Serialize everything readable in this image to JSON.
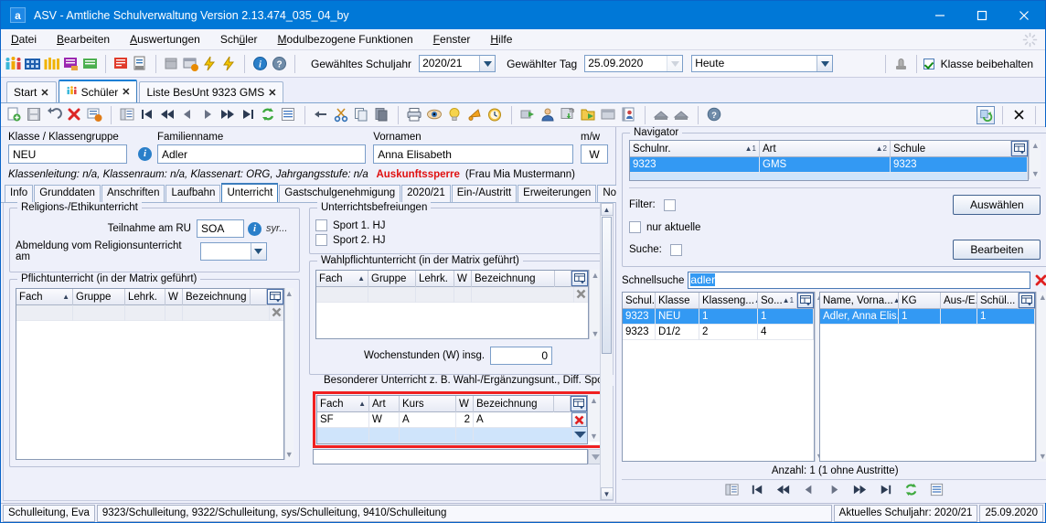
{
  "window": {
    "title": "ASV - Amtliche Schulverwaltung Version 2.13.474_035_04_by",
    "app_icon_letter": "a",
    "minimize_label": "—",
    "maximize_label": "□",
    "close_label": "✕"
  },
  "menu": {
    "items": [
      {
        "label": "Datei",
        "mnemonic": "D"
      },
      {
        "label": "Bearbeiten",
        "mnemonic": "B"
      },
      {
        "label": "Auswertungen",
        "mnemonic": "A"
      },
      {
        "label": "Schüler",
        "mnemonic": "u"
      },
      {
        "label": "Modulbezogene Funktionen",
        "mnemonic": "M"
      },
      {
        "label": "Fenster",
        "mnemonic": "F"
      },
      {
        "label": "Hilfe",
        "mnemonic": "H"
      }
    ]
  },
  "toolbar": {
    "school_year_label": "Gewähltes Schuljahr",
    "school_year_value": "2020/21",
    "day_label": "Gewählter Tag",
    "day_value": "25.09.2020",
    "period_value": "Heute",
    "keep_class_label": "Klasse beibehalten",
    "keep_class_checked": true,
    "icons": [
      "students-icon",
      "school-building-icon",
      "class-icon",
      "report-violet-icon",
      "report-green-icon",
      "book-red-icon",
      "print-report-icon",
      "package-icon",
      "window-alert-icon",
      "lightning-icon",
      "lightning2-icon",
      "info-icon",
      "help-icon",
      "stamp-icon"
    ]
  },
  "tabs": [
    {
      "label": "Start",
      "active": false,
      "icon": "none",
      "closable": true
    },
    {
      "label": "Schüler",
      "active": true,
      "icon": "students-icon",
      "closable": true
    },
    {
      "label": "Liste BesUnt 9323 GMS",
      "active": false,
      "icon": "none",
      "closable": true
    }
  ],
  "doc_toolbar": {
    "icons": [
      "new-icon",
      "save-icon",
      "undo-icon",
      "delete-icon",
      "edit-record-icon",
      "record-list-icon",
      "first-icon",
      "prev-page-icon",
      "prev-icon",
      "next-icon",
      "next-page-icon",
      "last-icon",
      "refresh-icon",
      "list-icon",
      "back-icon",
      "cut-icon",
      "copy-icon",
      "paste-icon",
      "print-icon",
      "preview-icon",
      "hint-icon",
      "bell-icon",
      "clock-icon",
      "export-icon",
      "person-icon",
      "tb-import-icon",
      "folder-export-icon",
      "window-icon",
      "contacts-icon",
      "stamp1-icon",
      "stamp2-icon",
      "help-circle-icon"
    ],
    "right_icons": [
      "refresh-green-icon",
      "close-doc-icon"
    ]
  },
  "header_form": {
    "class_label": "Klasse / Klassengruppe",
    "class_value": "NEU",
    "lastname_label": "Familienname",
    "lastname_value": "Adler",
    "firstname_label": "Vornamen",
    "firstname_value": "Anna Elisabeth",
    "gender_label": "m/w",
    "gender_value": "W",
    "meta_text": "Klassenleitung: n/a, Klassenraum: n/a, Klassenart: ORG, Jahrgangsstufe: n/a",
    "lock_text": "Auskunftssperre",
    "lock_who": "(Frau Mia Mustermann)"
  },
  "form_tabs": [
    {
      "label": "Info",
      "selected": false
    },
    {
      "label": "Grunddaten",
      "selected": false
    },
    {
      "label": "Anschriften",
      "selected": false
    },
    {
      "label": "Laufbahn",
      "selected": false
    },
    {
      "label": "Unterricht",
      "selected": true
    },
    {
      "label": "Gastschulgenehmigung",
      "selected": false
    },
    {
      "label": "2020/21",
      "selected": false
    },
    {
      "label": "Ein-/Austritt",
      "selected": false
    },
    {
      "label": "Erweiterungen",
      "selected": false
    },
    {
      "label": "Noten",
      "selected": false
    }
  ],
  "religion": {
    "group_title": "Religions-/Ethikunterricht",
    "ru_label": "Teilnahme am RU",
    "ru_value": "SOA",
    "ru_hint": "syr...",
    "abmeldung_label": "Abmeldung vom Religionsunterricht am",
    "abmeldung_value": ""
  },
  "pflicht": {
    "group_title": "Pflichtunterricht (in der Matrix geführt)",
    "columns": [
      "Fach",
      "Gruppe",
      "Lehrk.",
      "W",
      "Bezeichnung"
    ],
    "sort_col": "Fach",
    "rows": [
      [
        "",
        "",
        "",
        "",
        ""
      ]
    ]
  },
  "befreiungen": {
    "group_title": "Unterrichtsbefreiungen",
    "items": [
      {
        "label": "Sport 1. HJ",
        "checked": false
      },
      {
        "label": "Sport 2. HJ",
        "checked": false
      }
    ]
  },
  "wahlpflicht": {
    "group_title": "Wahlpflichtunterricht (in der Matrix geführt)",
    "columns": [
      "Fach",
      "Gruppe",
      "Lehrk.",
      "W",
      "Bezeichnung"
    ],
    "sort_col": "Fach",
    "rows": [
      [
        "",
        "",
        "",
        "",
        ""
      ]
    ],
    "weekhours_label": "Wochenstunden (W) insg.",
    "weekhours_value": "0"
  },
  "besonderer": {
    "group_title": "Besonderer Unterricht z. B. Wahl-/Ergänzungsunt., Diff. Sport",
    "columns": [
      "Fach",
      "Art",
      "Kurs",
      "W",
      "Bezeichnung"
    ],
    "sort_col": "Fach",
    "highlight_color": "#f02020",
    "rows": [
      [
        "SF",
        "W",
        "A",
        "2",
        "A"
      ],
      [
        "",
        "",
        "",
        "",
        ""
      ]
    ]
  },
  "navigator": {
    "group_title": "Navigator",
    "columns": [
      {
        "label": "Schulnr.",
        "sort": "▲1"
      },
      {
        "label": "Art",
        "sort": "▲2"
      },
      {
        "label": "Schule",
        "sort": ""
      }
    ],
    "rows": [
      {
        "cells": [
          "9323",
          "GMS",
          "9323"
        ],
        "selected": true
      }
    ],
    "filter_label": "Filter:",
    "only_current_label": "nur aktuelle",
    "only_current_checked": false,
    "search_label": "Suche:",
    "select_button": "Auswählen",
    "edit_button": "Bearbeiten"
  },
  "quicksearch": {
    "label": "Schnellsuche",
    "value": "adler",
    "clear_icon": "clear-red-x-icon"
  },
  "class_table": {
    "columns": [
      {
        "label": "Schul...",
        "sort": ""
      },
      {
        "label": "Klasse",
        "sort": ""
      },
      {
        "label": "Klasseng...",
        "sort": "▲2"
      },
      {
        "label": "So...",
        "sort": "▲1"
      }
    ],
    "rows": [
      {
        "cells": [
          "9323",
          "NEU",
          "1",
          "1"
        ],
        "selected": true
      },
      {
        "cells": [
          "9323",
          "D1/2",
          "2",
          "4"
        ],
        "selected": false
      }
    ]
  },
  "student_table": {
    "columns": [
      {
        "label": "Name, Vorna...",
        "sort": "▲"
      },
      {
        "label": "KG",
        "sort": ""
      },
      {
        "label": "Aus-/E...",
        "sort": ""
      },
      {
        "label": "Schül...",
        "sort": ""
      }
    ],
    "rows": [
      {
        "cells": [
          "Adler, Anna Elis...",
          "1",
          "",
          "1"
        ],
        "selected": true
      }
    ]
  },
  "nav_footer": {
    "count_text": "Anzahl: 1 (1 ohne Austritte)",
    "buttons": [
      "record-list-icon",
      "first-icon",
      "prev-page-icon",
      "prev-icon",
      "next-icon",
      "next-page-icon",
      "last-icon",
      "refresh-icon",
      "list-icon"
    ]
  },
  "statusbar": {
    "user": "Schulleitung, Eva",
    "roles": "9323/Schulleitung, 9322/Schulleitung, sys/Schulleitung, 9410/Schulleitung",
    "current_year": "Aktuelles Schuljahr: 2020/21",
    "date": "25.09.2020"
  }
}
